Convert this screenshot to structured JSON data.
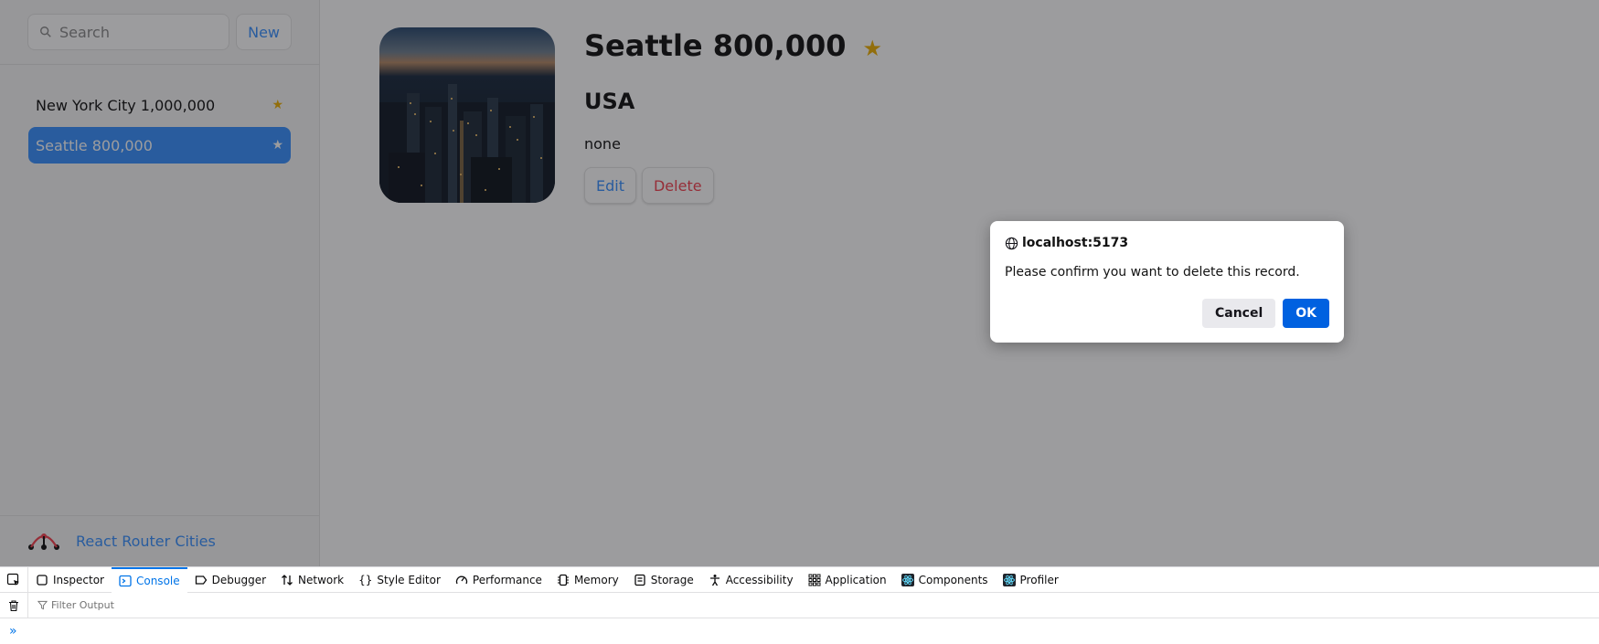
{
  "sidebar": {
    "search_placeholder": "Search",
    "new_label": "New",
    "items": [
      {
        "label": "New York City 1,000,000",
        "star": "★"
      },
      {
        "label": "Seattle 800,000",
        "star": "★"
      }
    ],
    "brand": "React Router Cities"
  },
  "detail": {
    "title": "Seattle 800,000",
    "star": "★",
    "country": "USA",
    "notes": "none",
    "edit_label": "Edit",
    "delete_label": "Delete"
  },
  "dialog": {
    "host": "localhost:5173",
    "message": "Please confirm you want to delete this record.",
    "cancel_label": "Cancel",
    "ok_label": "OK"
  },
  "devtools": {
    "tabs": [
      {
        "label": "Inspector",
        "icon": "inspector-icon"
      },
      {
        "label": "Console",
        "icon": "console-icon",
        "active": true
      },
      {
        "label": "Debugger",
        "icon": "debugger-icon"
      },
      {
        "label": "Network",
        "icon": "network-icon"
      },
      {
        "label": "Style Editor",
        "icon": "style-editor-icon"
      },
      {
        "label": "Performance",
        "icon": "performance-icon"
      },
      {
        "label": "Memory",
        "icon": "memory-icon"
      },
      {
        "label": "Storage",
        "icon": "storage-icon"
      },
      {
        "label": "Accessibility",
        "icon": "accessibility-icon"
      },
      {
        "label": "Application",
        "icon": "application-icon"
      },
      {
        "label": "Components",
        "icon": "react-components-icon"
      },
      {
        "label": "Profiler",
        "icon": "react-profiler-icon"
      }
    ],
    "filter_placeholder": "Filter Output"
  },
  "colors": {
    "accent": "#3992ff",
    "star": "#eeb004",
    "danger": "#f44250",
    "dialog_ok": "#0061e0"
  }
}
